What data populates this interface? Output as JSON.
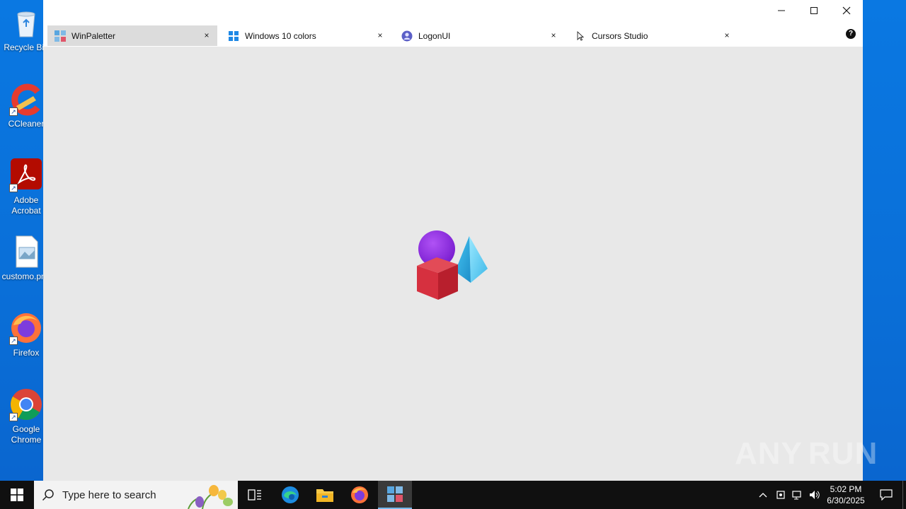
{
  "desktop": {
    "icons": [
      {
        "label": "Recycle Bin",
        "icon": "recycle-bin-icon"
      },
      {
        "label": "CCleaner",
        "icon": "ccleaner-icon"
      },
      {
        "label": "Adobe Acrobat",
        "icon": "adobe-acrobat-icon"
      },
      {
        "label": "customo.png",
        "icon": "image-file-icon"
      },
      {
        "label": "Firefox",
        "icon": "firefox-icon"
      },
      {
        "label": "Google Chrome",
        "icon": "chrome-icon"
      }
    ],
    "watermark": {
      "left": "ANY",
      "right": "RUN"
    }
  },
  "window": {
    "controls": {
      "minimize": "—",
      "maximize": "☐",
      "close": "✕"
    },
    "tabs": [
      {
        "label": "WinPaletter",
        "icon": "winpaletter-icon",
        "close": "×",
        "active": true
      },
      {
        "label": "Windows 10 colors",
        "icon": "windows-logo-icon",
        "close": "×",
        "active": false
      },
      {
        "label": "LogonUI",
        "icon": "user-icon",
        "close": "×",
        "active": false
      },
      {
        "label": "Cursors Studio",
        "icon": "cursor-icon",
        "close": "×",
        "active": false
      }
    ],
    "help": "?"
  },
  "taskbar": {
    "search_placeholder": "Type here to search",
    "apps": [
      "task-view-icon",
      "edge-icon",
      "file-explorer-icon",
      "firefox-icon",
      "winpaletter-icon"
    ],
    "clock": {
      "time": "5:02 PM",
      "date": "6/30/2025"
    }
  },
  "colors": {
    "desktop": "#0a78e2",
    "taskbar": "#101010",
    "app_background": "#e8e8e8",
    "active_tab": "#dcdcdc"
  }
}
